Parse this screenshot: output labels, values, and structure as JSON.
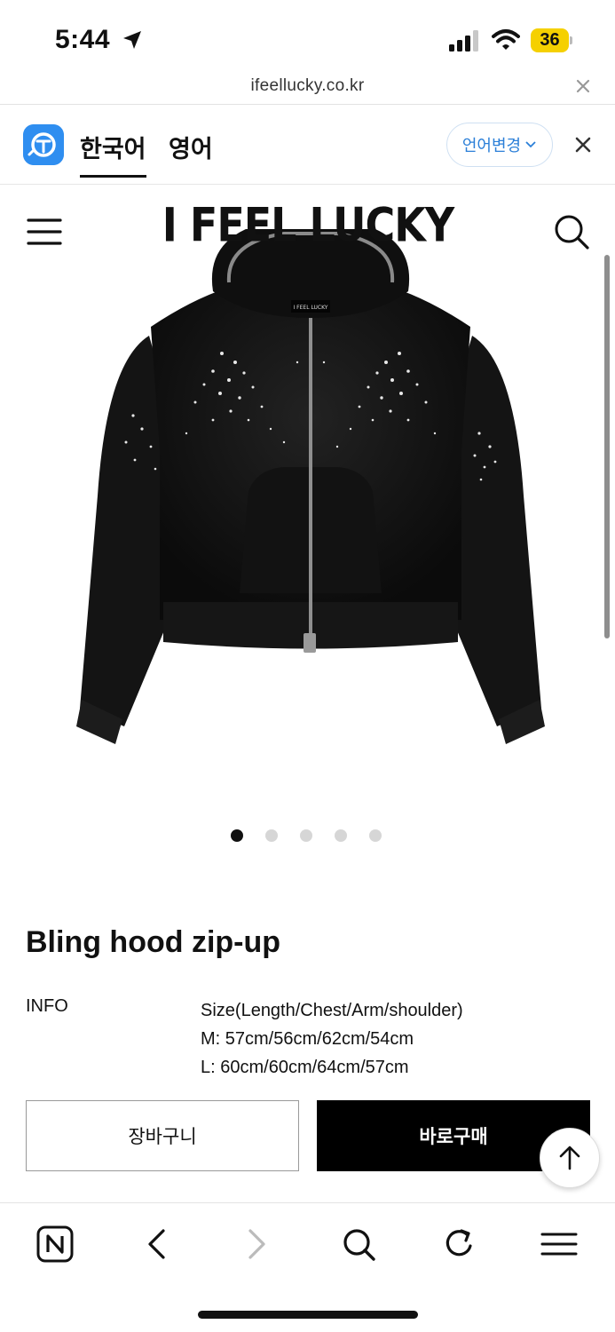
{
  "status_bar": {
    "time": "5:44",
    "battery": "36",
    "battery_color": "#f5d000",
    "icons": [
      "location-arrow-icon",
      "cellular-signal-icon",
      "wifi-icon",
      "battery-icon"
    ]
  },
  "address_bar": {
    "url": "ifeellucky.co.kr",
    "close_icon": "close-icon"
  },
  "translate_bar": {
    "logo_icon": "translate-logo-icon",
    "logo_color": "#2f8ef0",
    "languages": [
      {
        "label": "한국어",
        "active": true
      },
      {
        "label": "영어",
        "active": false
      }
    ],
    "change_label": "언어변경",
    "close_icon": "close-icon"
  },
  "site_header": {
    "brand": "I FEEL LUCKY",
    "menu_icon": "hamburger-menu-icon",
    "search_icon": "search-icon"
  },
  "product": {
    "image_icon": "black-hoodie-image",
    "garment_tag": "I FEEL LUCKY",
    "gallery": {
      "count": 5,
      "active_index": 0
    },
    "title": "Bling hood zip-up",
    "info_label": "INFO",
    "info_lines": [
      "Size(Length/Chest/Arm/shoulder)",
      "M: 57cm/56cm/62cm/54cm",
      "L: 60cm/60cm/64cm/57cm"
    ]
  },
  "actions": {
    "cart_label": "장바구니",
    "buy_label": "바로구매",
    "scroll_top_icon": "arrow-up-icon"
  },
  "browser_toolbar": {
    "items": [
      {
        "icon": "naver-home-icon"
      },
      {
        "icon": "back-arrow-icon"
      },
      {
        "icon": "forward-arrow-icon",
        "disabled": true
      },
      {
        "icon": "search-icon"
      },
      {
        "icon": "refresh-icon"
      },
      {
        "icon": "menu-icon"
      }
    ]
  }
}
